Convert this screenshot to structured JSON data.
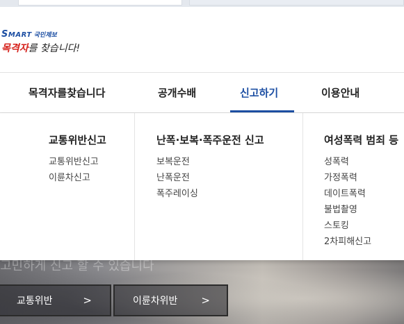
{
  "logo": {
    "smart_s": "S",
    "smart_rest": "MART",
    "sub": "국민제보",
    "main_red": "목격자",
    "main_rest": "를 찾습니다!"
  },
  "nav": {
    "items": [
      "목격자를찾습니다",
      "공개수배",
      "신고하기",
      "이용안내"
    ],
    "active": "신고하기"
  },
  "dropdown": {
    "columns": [
      {
        "title": "교통위반신고",
        "items": [
          "교통위반신고",
          "이륜차신고"
        ]
      },
      {
        "title": "난폭·보복·폭주운전 신고",
        "items": [
          "보복운전",
          "난폭운전",
          "폭주레이싱"
        ]
      },
      {
        "title": "여성폭력 범죄 등",
        "items": [
          "성폭력",
          "가정폭력",
          "데이트폭력",
          "불법촬영",
          "스토킹",
          "2차피해신고"
        ]
      }
    ]
  },
  "hero": {
    "faded_text": "고민하게 신고 할 수 있습니다",
    "buttons": [
      {
        "label": "교통위반",
        "arrow": ">"
      },
      {
        "label": "이륜차위반",
        "arrow": ">"
      }
    ]
  },
  "colors": {
    "brand_blue": "#1d4fa3",
    "brand_red": "#d6211b"
  }
}
